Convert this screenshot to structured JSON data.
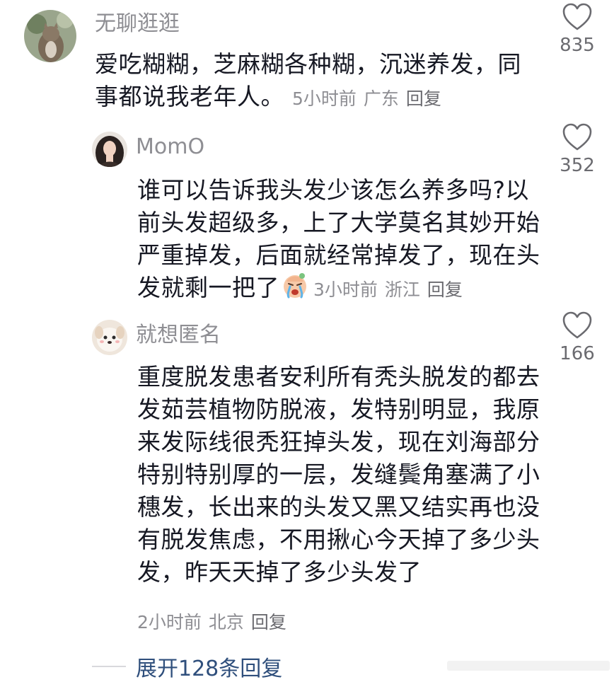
{
  "comments": [
    {
      "username": "无聊逛逛",
      "lines": [
        "爱吃糊糊，芝麻糊各种糊，沉迷养发，同",
        "事都说我老年人。"
      ],
      "time": "5小时前",
      "location": "广东",
      "reply_label": "回复",
      "likes": "835"
    },
    {
      "username": "MomO",
      "lines": [
        "谁可以告诉我头发少该怎么养多吗?以",
        "前头发超级多，上了大学莫名其妙开始",
        "严重掉发，后面就经常掉发了，现在头",
        "发就剩一把了"
      ],
      "time": "3小时前",
      "location": "浙江",
      "reply_label": "回复",
      "likes": "352",
      "emoji": "crying-face-emoji"
    },
    {
      "username": "就想匿名",
      "lines": [
        "重度脱发患者安利所有秃头脱发的都去",
        "发茹芸植物防脱液，发特别明显，我原",
        "来发际线很秃狂掉头发，现在刘海部分",
        "特别特别厚的一层，发缝鬓角塞满了小",
        "穗发，长出来的头发又黑又结实再也没",
        "有脱发焦虑，不用揪心今天掉了多少头",
        "发，昨天天掉了多少头发了"
      ],
      "time": "2小时前",
      "location": "北京",
      "reply_label": "回复",
      "likes": "166"
    }
  ],
  "expand_label": "展开128条回复",
  "colors": {
    "text": "#161823",
    "muted": "#8e8e93",
    "link": "#2f4f7c",
    "heart_stroke": "#6b6b70"
  }
}
